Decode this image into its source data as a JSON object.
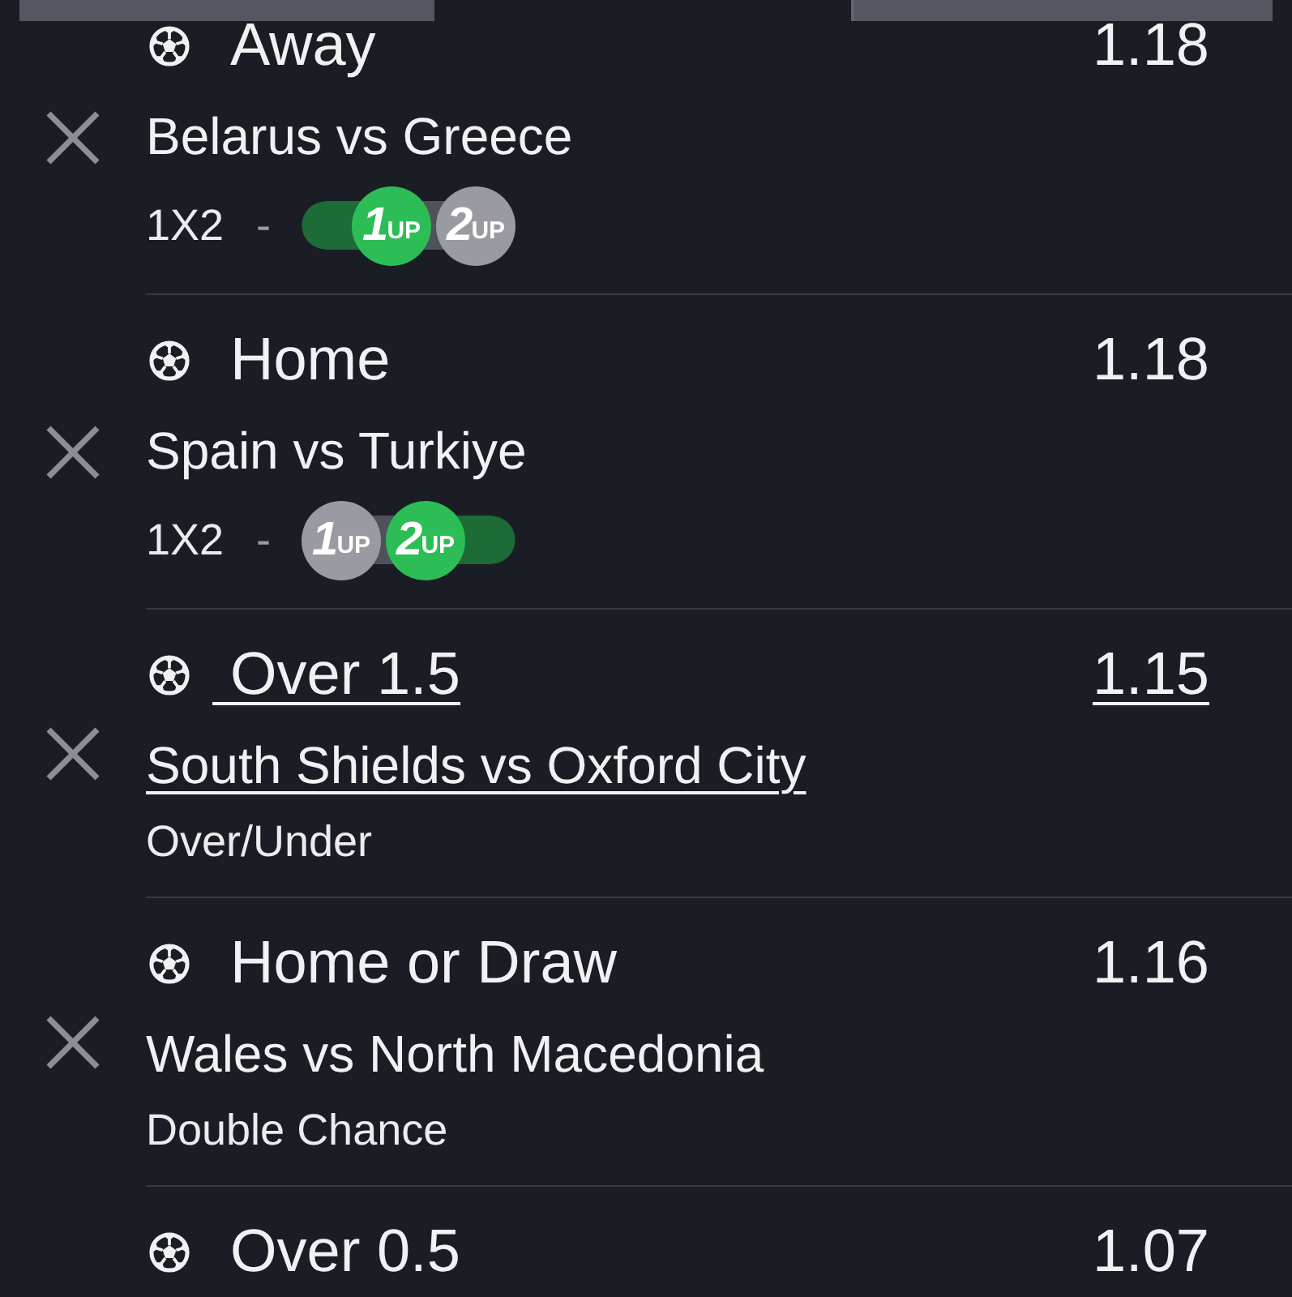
{
  "bets": [
    {
      "selection": "Away",
      "odds": "1.18",
      "underlined": false,
      "match": "Belarus vs Greece",
      "market": "1X2",
      "separator": "-",
      "boost_options": [
        {
          "number": "1",
          "suffix": "UP",
          "selected": true
        },
        {
          "number": "2",
          "suffix": "UP",
          "selected": false
        }
      ]
    },
    {
      "selection": "Home",
      "odds": "1.18",
      "underlined": false,
      "match": "Spain vs Turkiye",
      "market": "1X2",
      "separator": "-",
      "boost_options": [
        {
          "number": "1",
          "suffix": "UP",
          "selected": false
        },
        {
          "number": "2",
          "suffix": "UP",
          "selected": true
        }
      ]
    },
    {
      "selection": "Over 1.5",
      "odds": "1.15",
      "underlined": true,
      "match": "South Shields vs Oxford City",
      "market": "Over/Under"
    },
    {
      "selection": "Home or Draw",
      "odds": "1.16",
      "underlined": false,
      "match": "Wales vs North Macedonia",
      "market": "Double Chance"
    },
    {
      "selection": "Over 0.5",
      "odds": "1.07",
      "underlined": false
    }
  ]
}
